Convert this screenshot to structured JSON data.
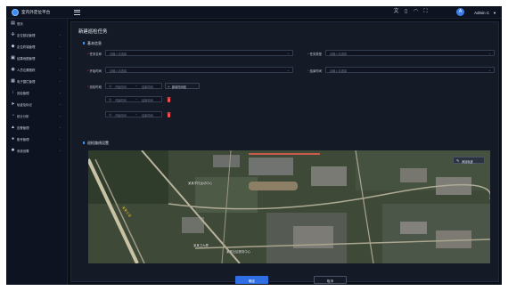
{
  "app": {
    "title": "室内外定位平台"
  },
  "header": {
    "icons": [
      "translate-icon",
      "document-icon",
      "bell-icon",
      "fullscreen-icon"
    ],
    "user": {
      "avatar_letter": "A",
      "name": "Admin C"
    }
  },
  "sidebar": {
    "items": [
      {
        "label": "首页",
        "icon": "home-icon",
        "has_children": false
      },
      {
        "label": "定位基站管理",
        "icon": "antenna-icon",
        "has_children": true
      },
      {
        "label": "定位终端管理",
        "icon": "tag-icon",
        "has_children": true
      },
      {
        "label": "结果地图管理",
        "icon": "map-icon",
        "has_children": true
      },
      {
        "label": "人员位置跟踪",
        "icon": "person-location-icon",
        "has_children": true
      },
      {
        "label": "电子围栏管理",
        "icon": "fence-icon",
        "has_children": true
      },
      {
        "label": "巡检管理",
        "icon": "inspection-icon",
        "has_children": true
      },
      {
        "label": "轨迹及标记",
        "icon": "track-icon",
        "has_children": true
      },
      {
        "label": "统计分析",
        "icon": "pie-chart-icon",
        "has_children": true
      },
      {
        "label": "告警管理",
        "icon": "alarm-icon",
        "has_children": true
      },
      {
        "label": "账号管理",
        "icon": "user-icon",
        "has_children": true
      },
      {
        "label": "系统设置",
        "icon": "gear-icon",
        "has_children": true
      }
    ]
  },
  "form": {
    "page_title": "新建巡检任务",
    "basic_section_title": "基本信息",
    "fields": {
      "task_name": {
        "label": "任务名称",
        "placeholder": "请输入请选择"
      },
      "task_type": {
        "label": "任务类型",
        "placeholder": "请输入请选择"
      },
      "start_date": {
        "label": "开始时间",
        "placeholder": "请输入请选择"
      },
      "end_date": {
        "label": "结束时间",
        "placeholder": "请输入请选择"
      },
      "patrol_time": {
        "label": "巡检时段"
      }
    },
    "time_ranges": [
      {
        "start": "开始时间",
        "sep": "~",
        "end": "结束时间"
      },
      {
        "start": "开始时间",
        "sep": "~",
        "end": "结束时间"
      },
      {
        "start": "开始时间",
        "sep": "~",
        "end": "结束时间"
      }
    ],
    "add_time_label": "新增时间段",
    "route_section_title": "巡检路线设置",
    "map": {
      "draw_button_label": "添加轨迹",
      "labels": [
        "某某学校运动中心",
        "某某卫大厦",
        "某某社区服务中心",
        "某某大道"
      ]
    }
  },
  "footer": {
    "confirm_label": "确定",
    "cancel_label": "取消"
  }
}
